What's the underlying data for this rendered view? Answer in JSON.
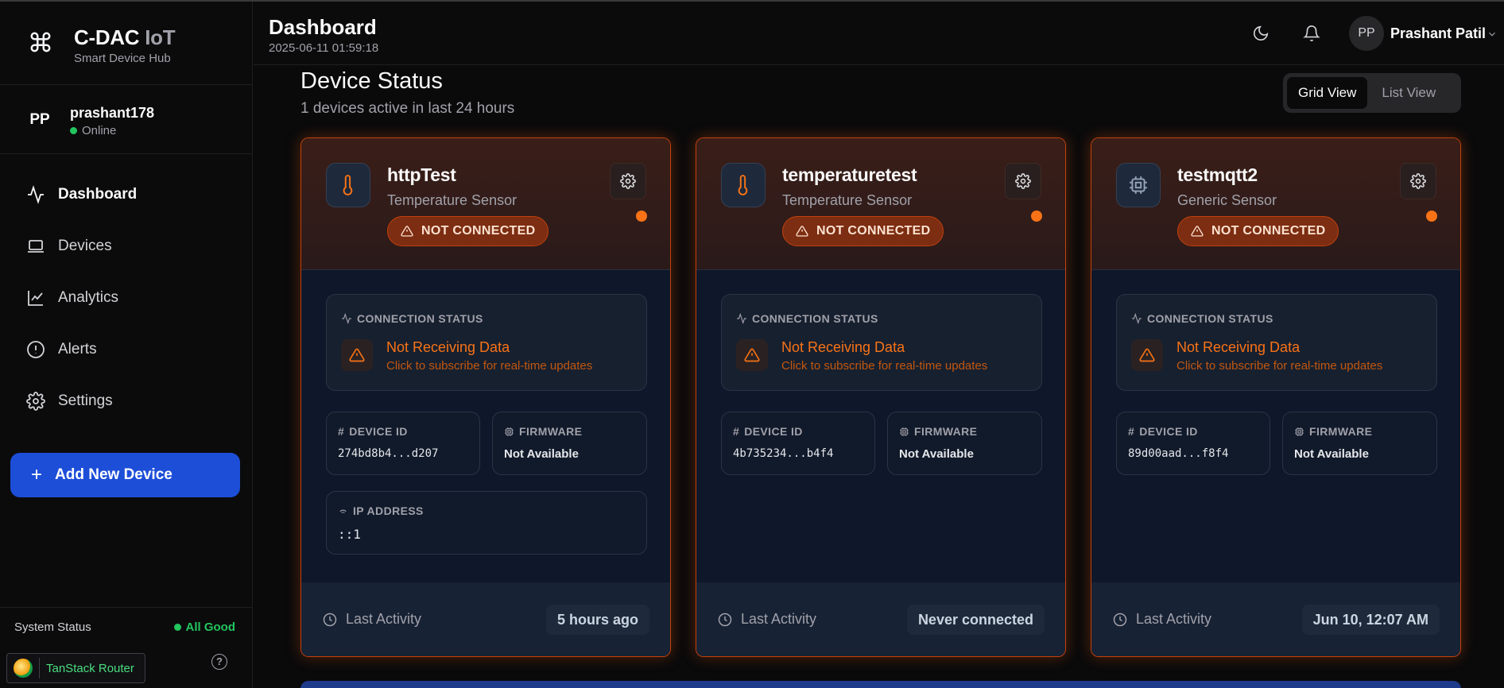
{
  "brand": {
    "title_main": "C-DAC",
    "title_accent": "IoT",
    "subtitle": "Smart Device Hub"
  },
  "user": {
    "initials": "PP",
    "username": "prashant178",
    "status": "Online"
  },
  "nav": [
    {
      "label": "Dashboard",
      "icon": "activity-icon",
      "active": true
    },
    {
      "label": "Devices",
      "icon": "laptop-icon",
      "active": false
    },
    {
      "label": "Analytics",
      "icon": "chart-line-icon",
      "active": false
    },
    {
      "label": "Alerts",
      "icon": "alert-circle-icon",
      "active": false
    },
    {
      "label": "Settings",
      "icon": "gear-icon",
      "active": false
    }
  ],
  "add_device_label": "Add New Device",
  "system": {
    "label": "System Status",
    "value": "All Good"
  },
  "devtools": {
    "label": "TanStack Router"
  },
  "header": {
    "title": "Dashboard",
    "timestamp": "2025-06-11 01:59:18",
    "avatar_initials": "PP",
    "user_name": "Prashant Patil"
  },
  "main": {
    "title": "Device Status",
    "subtitle": "1 devices active in last 24 hours",
    "views": [
      "Grid View",
      "List View"
    ],
    "active_view": "Grid View"
  },
  "labels": {
    "not_connected": "NOT CONNECTED",
    "connection_status": "CONNECTION STATUS",
    "not_receiving": "Not Receiving Data",
    "subscribe_hint": "Click to subscribe for real-time updates",
    "device_id": "DEVICE ID",
    "firmware": "FIRMWARE",
    "ip_address": "IP ADDRESS",
    "last_activity": "Last Activity"
  },
  "devices": [
    {
      "name": "httpTest",
      "type": "Temperature Sensor",
      "icon": "thermometer-icon",
      "device_id": "274bd8b4...d207",
      "firmware": "Not Available",
      "ip": "::1",
      "last_activity": "5 hours ago"
    },
    {
      "name": "temperaturetest",
      "type": "Temperature Sensor",
      "icon": "thermometer-icon",
      "device_id": "4b735234...b4f4",
      "firmware": "Not Available",
      "last_activity": "Never connected"
    },
    {
      "name": "testmqtt2",
      "type": "Generic Sensor",
      "icon": "cpu-icon",
      "device_id": "89d00aad...f8f4",
      "firmware": "Not Available",
      "last_activity": "Jun 10, 12:07 AM"
    }
  ],
  "colors": {
    "accent": "#1d4ed8",
    "warning": "#f97316",
    "online": "#22c55e",
    "card_border": "#c2410c"
  }
}
